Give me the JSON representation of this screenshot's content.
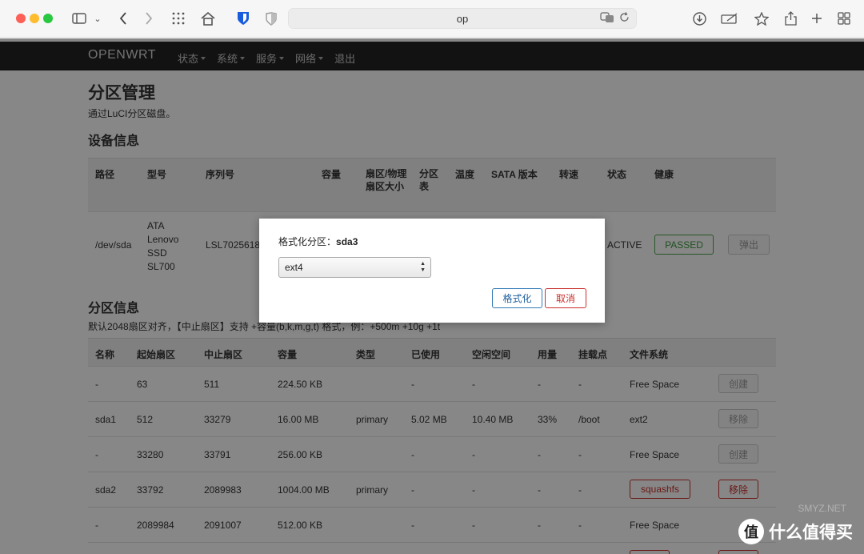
{
  "browser": {
    "url": "op"
  },
  "nav": {
    "brand": "OPENWRT",
    "menu": [
      "状态",
      "系统",
      "服务",
      "网络",
      "退出"
    ]
  },
  "page": {
    "title": "分区管理",
    "description": "通过LuCI分区磁盘。",
    "device_section": "设备信息",
    "partition_section": "分区信息",
    "partition_hint": "默认2048扇区对齐，【中止扇区】支持 +容量(b,k,m,g,t) 格式，例：+500m +10g +1t"
  },
  "device_table": {
    "headers": [
      "路径",
      "型号",
      "序列号",
      "容量",
      "扇区/物理扇区大小",
      "分区表",
      "温度",
      "SATA 版本",
      "转速",
      "状态",
      "健康"
    ],
    "row": {
      "path": "/dev/sda",
      "model": [
        "ATA",
        "Lenovo",
        "SSD",
        "SL700"
      ],
      "serial": "LSL7025618",
      "status": "ACTIVE",
      "health": "PASSED",
      "eject": "弹出"
    }
  },
  "partition_table": {
    "headers": [
      "名称",
      "起始扇区",
      "中止扇区",
      "容量",
      "类型",
      "已使用",
      "空闲空间",
      "用量",
      "挂载点",
      "文件系统"
    ],
    "rows": [
      {
        "name": "-",
        "start": "63",
        "end": "511",
        "size": "224.50 KB",
        "type": "",
        "used": "-",
        "free": "-",
        "usage": "-",
        "mount": "-",
        "fs": "Free Space",
        "action": "创建"
      },
      {
        "name": "sda1",
        "start": "512",
        "end": "33279",
        "size": "16.00 MB",
        "type": "primary",
        "used": "5.02 MB",
        "free": "10.40 MB",
        "usage": "33%",
        "mount": "/boot",
        "fs": "ext2",
        "action": "移除"
      },
      {
        "name": "-",
        "start": "33280",
        "end": "33791",
        "size": "256.00 KB",
        "type": "",
        "used": "-",
        "free": "-",
        "usage": "-",
        "mount": "-",
        "fs": "Free Space",
        "action": "创建"
      },
      {
        "name": "sda2",
        "start": "33792",
        "end": "2089983",
        "size": "1004.00 MB",
        "type": "primary",
        "used": "-",
        "free": "-",
        "usage": "-",
        "mount": "-",
        "fs": "squashfs",
        "action": "移除"
      },
      {
        "name": "-",
        "start": "2089984",
        "end": "2091007",
        "size": "512.00 KB",
        "type": "",
        "used": "-",
        "free": "-",
        "usage": "-",
        "mount": "-",
        "fs": "Free Space",
        "action": ""
      }
    ]
  },
  "modal": {
    "label": "格式化分区：",
    "partition": "sda3",
    "fs_selected": "ext4",
    "format_button": "格式化",
    "cancel_button": "取消"
  },
  "watermark": {
    "text": "什么值得买",
    "icon_char": "值",
    "faint": "SMYZ.NET"
  }
}
